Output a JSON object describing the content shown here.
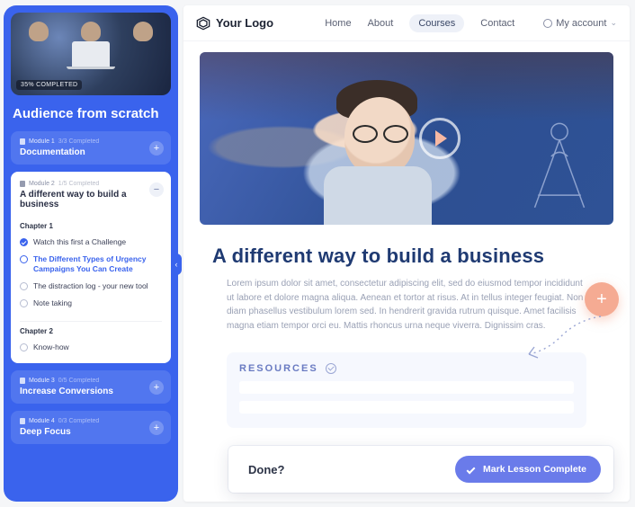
{
  "brand": {
    "name": "Your Logo"
  },
  "nav": {
    "home": "Home",
    "about": "About",
    "courses": "Courses",
    "contact": "Contact",
    "account": "My account"
  },
  "sidebar": {
    "progress_badge": "35% COMPLETED",
    "course_title": "Audience from scratch",
    "modules": [
      {
        "label": "Module 1",
        "status": "3/3 Completed",
        "title": "Documentation"
      },
      {
        "label": "Module 2",
        "status": "1/5 Completed",
        "title": "A different way to build a business",
        "chapters": [
          {
            "label": "Chapter 1",
            "lessons": [
              {
                "title": "Watch this first a Challenge",
                "state": "done"
              },
              {
                "title": "The Different Types of Urgency Campaigns You Can Create",
                "state": "current"
              },
              {
                "title": "The distraction log - your new tool",
                "state": "todo"
              },
              {
                "title": "Note taking",
                "state": "todo"
              }
            ]
          },
          {
            "label": "Chapter 2",
            "lessons": [
              {
                "title": "Know-how",
                "state": "todo"
              }
            ]
          }
        ]
      },
      {
        "label": "Module 3",
        "status": "0/5 Completed",
        "title": "Increase Conversions"
      },
      {
        "label": "Module 4",
        "status": "0/3 Completed",
        "title": "Deep Focus"
      }
    ]
  },
  "lesson": {
    "title": "A different way to build a business",
    "body": "Lorem ipsum dolor sit amet, consectetur adipiscing elit, sed do eiusmod tempor incididunt ut labore et dolore magna aliqua. Aenean et tortor at risus. At in tellus integer feugiat. Non diam phasellus vestibulum lorem sed. In hendrerit gravida rutrum quisque. Amet facilisis magna etiam tempor orci eu. Mattis rhoncus urna neque viverra. Dignissim cras.",
    "resources_heading": "RESOURCES"
  },
  "done": {
    "question": "Done?",
    "button": "Mark Lesson Complete"
  }
}
